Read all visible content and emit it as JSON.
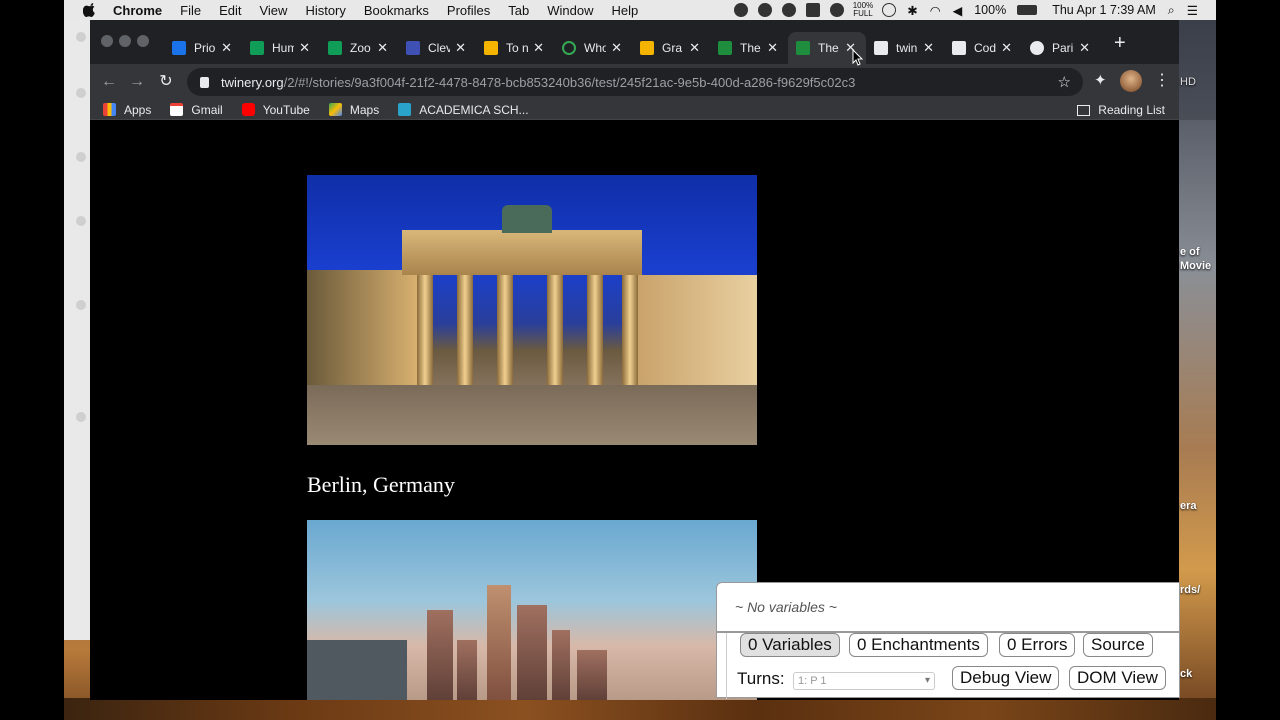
{
  "menubar": {
    "app": "Chrome",
    "items": [
      "File",
      "Edit",
      "View",
      "History",
      "Bookmarks",
      "Profiles",
      "Tab",
      "Window",
      "Help"
    ],
    "battery_small": "100%",
    "battery_small2": "FULL",
    "battery": "100%",
    "datetime": "Thu Apr 1  7:39 AM"
  },
  "tabs": [
    {
      "title": "Prio",
      "color": "#1a73e8"
    },
    {
      "title": "Hum",
      "color": "#0f9d58"
    },
    {
      "title": "Zoo",
      "color": "#0f9d58"
    },
    {
      "title": "Clev",
      "color": "#3f51b5"
    },
    {
      "title": "To n",
      "color": "#f4b400"
    },
    {
      "title": "Who",
      "color": "#34a853"
    },
    {
      "title": "Gra",
      "color": "#f4b400"
    },
    {
      "title": "The",
      "color": "#1e8e3e"
    },
    {
      "title": "The",
      "color": "#1e8e3e",
      "active": true
    },
    {
      "title": "twin",
      "color": "#e8eaed"
    },
    {
      "title": "Cod",
      "color": "#e8eaed"
    },
    {
      "title": "Pari",
      "color": "#e8eaed"
    }
  ],
  "omnibox": {
    "host": "twinery.org",
    "path": "/2/#!/stories/9a3f004f-21f2-4478-8478-bcb853240b36/test/245f21ac-9e5b-400d-a286-f9629f5c02c3"
  },
  "bookmarks": {
    "items": [
      "Apps",
      "Gmail",
      "YouTube",
      "Maps",
      "ACADEMICA SCH..."
    ],
    "reading_list": "Reading List"
  },
  "page": {
    "caption": "Berlin, Germany"
  },
  "debug": {
    "no_variables": "~ No variables ~",
    "variables": "0 Variables",
    "enchantments": "0 Enchantments",
    "errors": "0 Errors",
    "source": "Source",
    "turns_label": "Turns:",
    "turns_value": "1: P 1",
    "debug_view": "Debug View",
    "dom_view": "DOM View"
  },
  "desktop_labels": {
    "hd": "HD",
    "label1": "e of",
    "label2": "Movie",
    "label3": "era",
    "label4": "rds/",
    "label5": "ck"
  }
}
